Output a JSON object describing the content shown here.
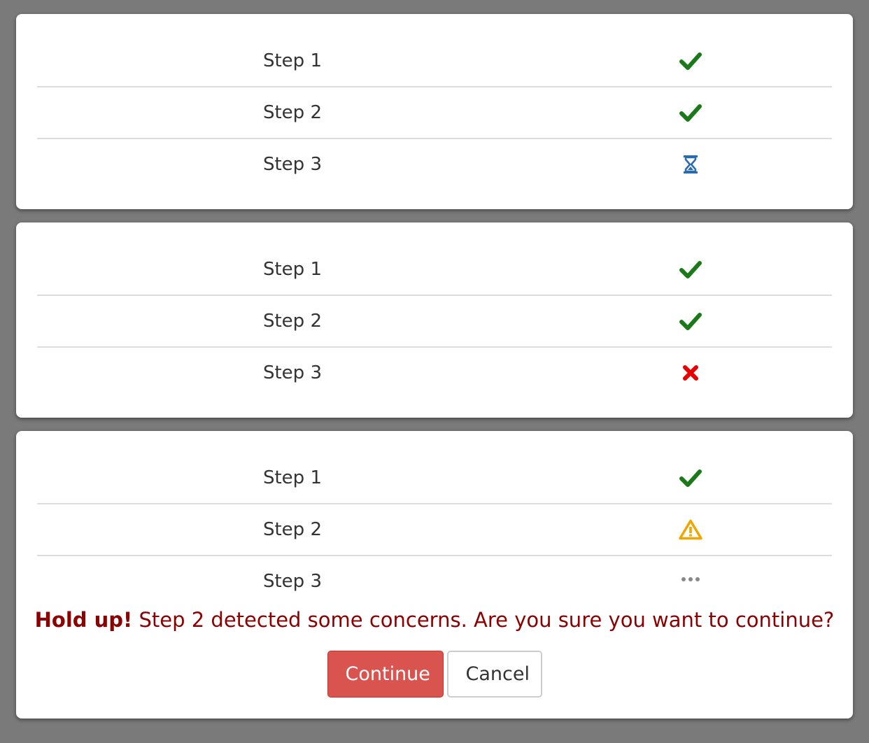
{
  "colors": {
    "success": "#1a7a1a",
    "pending": "#2a6bb0",
    "error": "#e60000",
    "warning": "#f0a500",
    "muted": "#888888",
    "danger_text": "#8b0000",
    "continue_bg": "#d9534f"
  },
  "panels": [
    {
      "steps": [
        {
          "label": "Step 1",
          "status": "check-icon"
        },
        {
          "label": "Step 2",
          "status": "check-icon"
        },
        {
          "label": "Step 3",
          "status": "hourglass-icon"
        }
      ]
    },
    {
      "steps": [
        {
          "label": "Step 1",
          "status": "check-icon"
        },
        {
          "label": "Step 2",
          "status": "check-icon"
        },
        {
          "label": "Step 3",
          "status": "cross-icon"
        }
      ]
    },
    {
      "steps": [
        {
          "label": "Step 1",
          "status": "check-icon"
        },
        {
          "label": "Step 2",
          "status": "warning-icon"
        },
        {
          "label": "Step 3",
          "status": "ellipsis-icon"
        }
      ],
      "warning": {
        "strong": "Hold up!",
        "message": " Step 2 detected some concerns. Are you sure you want to continue?"
      },
      "buttons": {
        "continue_label": "Continue",
        "cancel_label": "Cancel"
      }
    }
  ]
}
